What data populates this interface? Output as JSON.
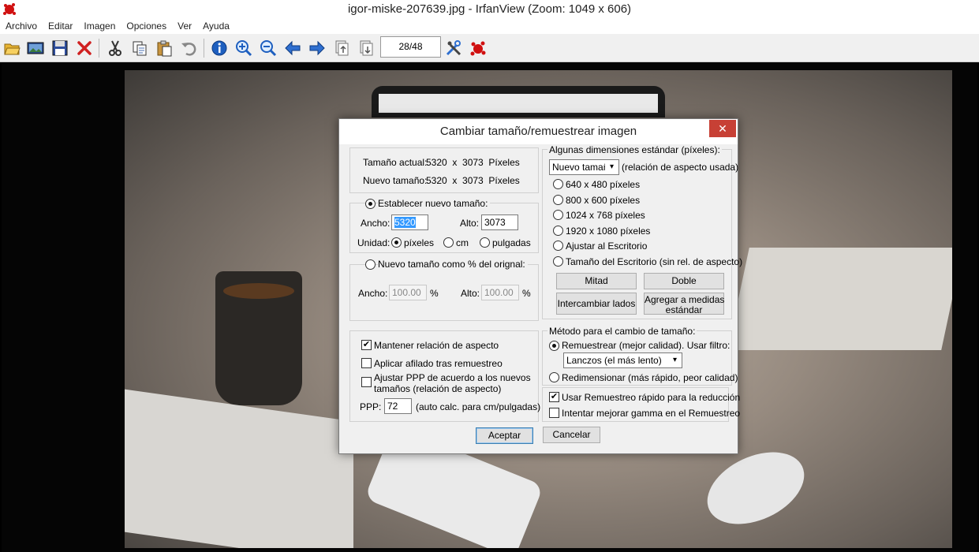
{
  "window": {
    "title": "igor-miske-207639.jpg - IrfanView (Zoom: 1049 x 606)"
  },
  "menu": [
    "Archivo",
    "Editar",
    "Imagen",
    "Opciones",
    "Ver",
    "Ayuda"
  ],
  "toolbar": {
    "page_counter": "28/48",
    "icons": [
      "open-folder-icon",
      "slideshow-icon",
      "save-icon",
      "delete-icon",
      "cut-icon",
      "copy-icon",
      "paste-icon",
      "undo-icon",
      "info-icon",
      "zoom-in-icon",
      "zoom-out-icon",
      "arrow-left-icon",
      "arrow-right-icon",
      "page-prev-icon",
      "page-next-icon",
      "settings-icon",
      "irfanview-icon"
    ]
  },
  "dialog": {
    "title": "Cambiar tamaño/remuestrear imagen",
    "close_glyph": "✕",
    "current_size_label": "Tamaño actual:",
    "current_size_value": "5320  x  3073  Píxeles",
    "new_size_label": "Nuevo tamaño:",
    "new_size_value": "5320  x  3073  Píxeles",
    "set_new_size_label": "Establecer nuevo tamaño:",
    "width_label": "Ancho:",
    "width_value": "5320",
    "height_label": "Alto:",
    "height_value": "3073",
    "unit_label": "Unidad:",
    "unit_pixels": "píxeles",
    "unit_cm": "cm",
    "unit_inches": "pulgadas",
    "percent_label": "Nuevo tamaño como % del orignal:",
    "pct_width_label": "Ancho:",
    "pct_width_value": "100.00",
    "pct_height_label": "Alto:",
    "pct_height_value": "100.00",
    "percent_sign": "%",
    "keep_aspect_label": "Mantener relación de aspecto",
    "apply_sharpen_label": "Aplicar afilado tras remuestreo",
    "adjust_dpi_label_1": "Ajustar PPP de acuerdo a los nuevos",
    "adjust_dpi_label_2": "tamaños (relación de aspecto)",
    "dpi_label": "PPP:",
    "dpi_value": "72",
    "dpi_hint": "(auto calc. para cm/pulgadas)",
    "standard_sizes_label": "Algunas dimensiones estándar (píxeles):",
    "standard_select_value": "Nuevo tamaño",
    "aspect_note": "(relación de aspecto usada)",
    "size_options": [
      "640 x 480 píxeles",
      "800 x 600 píxeles",
      "1024 x 768 píxeles",
      "1920 x 1080 píxeles",
      "Ajustar al Escritorio",
      "Tamaño del Escritorio (sin rel. de aspecto)"
    ],
    "half_button": "Mitad",
    "double_button": "Doble",
    "swap_button": "Intercambiar lados",
    "add_standard_button_1": "Agregar a medidas",
    "add_standard_button_2": "estándar",
    "method_label": "Método para el cambio de tamaño:",
    "resample_label": "Remuestrear (mejor calidad). Usar filtro:",
    "filter_value": "Lanczos (el más lento)",
    "resize_label": "Redimensionar (más rápido, peor calidad)",
    "fast_resample_label": "Usar Remuestreo rápido para la reducción",
    "gamma_label": "Intentar mejorar gamma en el Remuestreo",
    "ok_button": "Aceptar",
    "cancel_button": "Cancelar"
  }
}
